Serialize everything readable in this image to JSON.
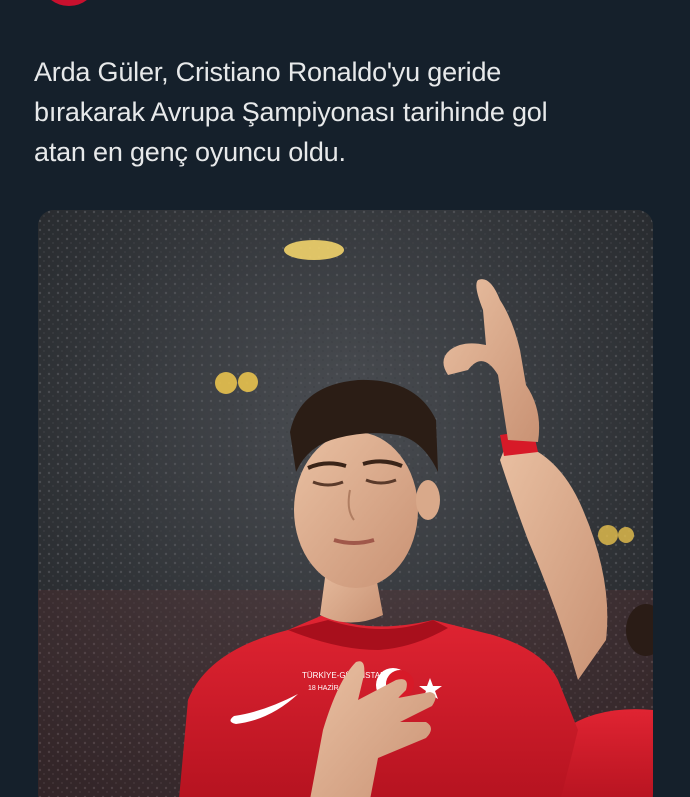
{
  "tweet": {
    "text_lines": [
      "Arda Güler, Cristiano Ronaldo'yu geride",
      "bırakarak Avrupa Şampiyonası tarihinde gol",
      "atan en genç oyuncu oldu."
    ]
  },
  "media": {
    "shirt_print_line1": "TÜRKİYE-GÜRCİSTAN",
    "shirt_print_line2": "18 HAZİRAN",
    "colors": {
      "jersey": "#d71a28",
      "background": "#15202b",
      "text": "#e7e9ea"
    }
  }
}
